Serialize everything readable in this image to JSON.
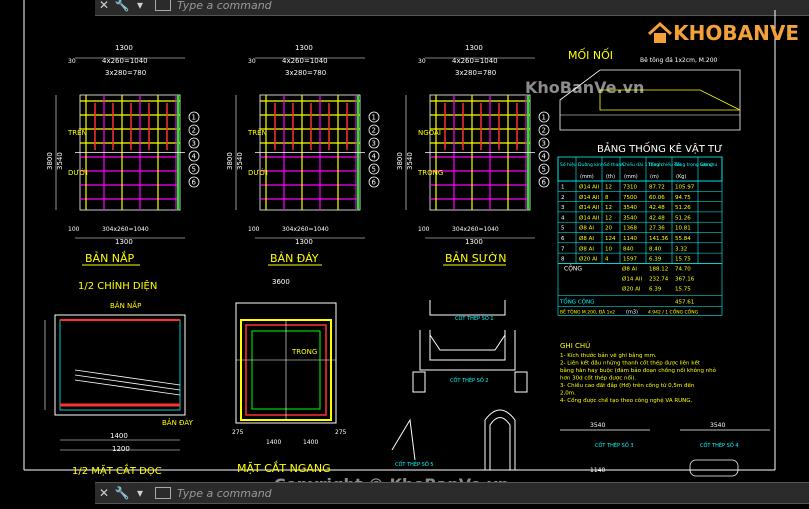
{
  "command_bar": {
    "placeholder": "Type a command"
  },
  "watermark": {
    "site": "KhoBanVe.vn",
    "copyright": "Copyright © KhoBanVe.vn",
    "logo": "KHOBANVE"
  },
  "drawing": {
    "views": {
      "ban_nap": "BẢN NẮP",
      "ban_day": "BẢN ĐÁY",
      "ban_suon": "BẢN SƯỜN",
      "chinh_dien": "1/2 CHÍNH DIỆN",
      "mat_cat_doc": "1/2 MẶT CẮT DỌC",
      "mat_cat_ngang": "MẶT CẮT NGANG",
      "moi_noi": "MỐI NỐI",
      "bang_thong_ke": "BẢNG THỐNG KÊ VẬT TƯ",
      "ghi_chu": "GHI CHÚ"
    },
    "dims": {
      "w1300": "1300",
      "w1040": "4x260=1040",
      "w780": "3x280=780",
      "w304": "304x260=1040",
      "h3800": "3800",
      "h3540": "3540",
      "d100": "100",
      "d30": "30",
      "d1400": "1400",
      "d1200": "1200",
      "d3600": "3600",
      "d2780": "7x280=",
      "d275": "275"
    },
    "labels": {
      "tren": "TRÊN",
      "duoi": "DƯỚI",
      "ngoai": "NGOÀI",
      "trong": "TRONG",
      "ban_suon_small": "BẢN SƯỜN",
      "ban_nap_small": "BẢN NẮP",
      "ban_day_small": "BẢN ĐÁY",
      "cot_thep_1": "CỐT THÉP SỐ 1",
      "cot_thep_2": "CỐT THÉP SỐ 2",
      "cot_thep_3": "CỐT THÉP SỐ 3",
      "cot_thep_4": "CỐT THÉP SỐ 4",
      "cot_thep_5": "CỐT THÉP SỐ 5",
      "be_tong_da": "Bê tông đá 1x2cm, M.200"
    },
    "table": {
      "headers": [
        "Số hiệu",
        "Đường kính",
        "Số thanh",
        "Chiều dài 1 thanh",
        "Tổng chiều dài",
        "Tổng trọng lượng",
        "Ghi chú"
      ],
      "units": [
        "",
        "(mm)",
        "(th)",
        "(mm)",
        "(m)",
        "(Kg)",
        ""
      ],
      "rows": [
        [
          "1",
          "Ø14 AII",
          "12",
          "7310",
          "87.72",
          "105.97"
        ],
        [
          "2",
          "Ø14 AII",
          "8",
          "7500",
          "60.06",
          "94.75"
        ],
        [
          "3",
          "Ø14 AII",
          "12",
          "3540",
          "42.48",
          "51.26"
        ],
        [
          "4",
          "Ø14 AII",
          "12",
          "3540",
          "42.48",
          "51.26"
        ],
        [
          "5",
          "Ø8 AI",
          "20",
          "1368",
          "27.36",
          "10.81"
        ],
        [
          "6",
          "Ø8 AI",
          "124",
          "1140",
          "141.36",
          "55.84"
        ],
        [
          "7",
          "Ø8 AI",
          "10",
          "840",
          "8.40",
          "3.32"
        ],
        [
          "8",
          "Ø20 AI",
          "4",
          "1597",
          "6.39",
          "15.75"
        ]
      ],
      "cong_label": "CỘNG",
      "cong_rows": [
        [
          "Ø8 AI",
          "188.12",
          "74.70"
        ],
        [
          "Ø14 AII",
          "232.74",
          "367.16"
        ],
        [
          "Ø20 AI",
          "6.39",
          "15.75"
        ]
      ],
      "tong_cong": "TỔNG CỘNG",
      "tong_value": "457.61",
      "be_tong": "BÊ TÔNG M.200, ĐÁ 1x2",
      "be_tong_unit": "(m3)",
      "be_tong_value": "4.942 / 1 CỐNG CỐNG"
    },
    "notes": [
      "1- Kích thước bản vẽ ghi bằng mm.",
      "2- Liên kết đầu những thanh cốt thép được liên kết bằng hàn hay buộc (đảm bảo đoạn chồng nối không nhỏ hơn 30d cốt thép được nối).",
      "3- Chiều cao đất đắp (Hđ) trên cống từ 0,5m đến 2,0m.",
      "4- Cống được chế tạo theo công nghệ VA RUNG."
    ],
    "bottom_dims": {
      "a": "3540",
      "b": "3540",
      "c": "1140"
    }
  },
  "colors": {
    "rebar_magenta": "#ff00ff",
    "rebar_red": "#ff3030",
    "rebar_green": "#00ff00",
    "rebar_yellow": "#ffff00",
    "dim_white": "#ffffff",
    "cyan": "#00ffff",
    "title_yellow": "#ffff00"
  }
}
